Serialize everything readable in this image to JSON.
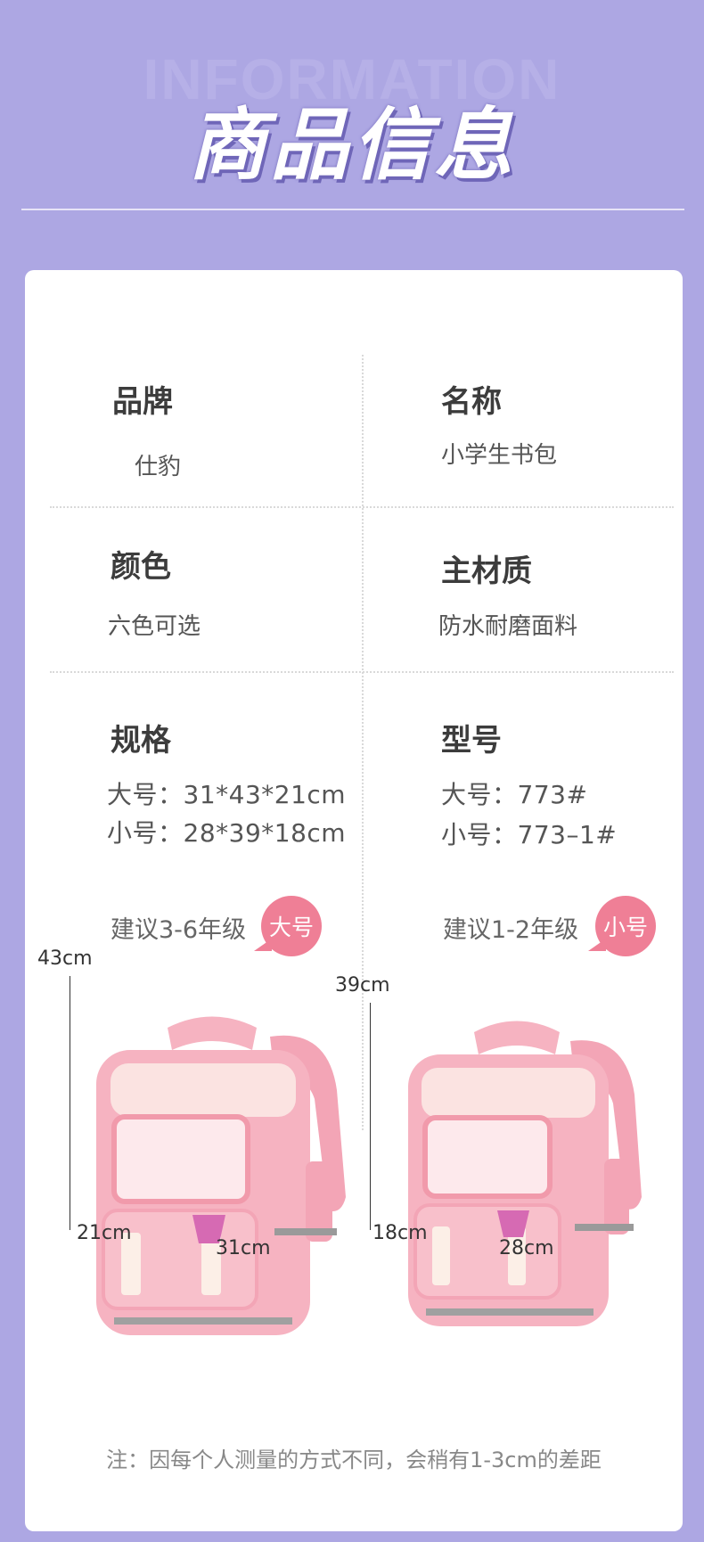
{
  "header": {
    "bg_word": "INFORMATION",
    "title": "商品信息"
  },
  "info": {
    "brand": {
      "label": "品牌",
      "value": "仕豹"
    },
    "name": {
      "label": "名称",
      "value": "小学生书包"
    },
    "color": {
      "label": "颜色",
      "value": "六色可选"
    },
    "material": {
      "label": "主材质",
      "value": "防水耐磨面料"
    },
    "spec": {
      "label": "规格",
      "large": "大号：31*43*21cm",
      "small": "小号：28*39*18cm"
    },
    "model": {
      "label": "型号",
      "large": "大号：773#",
      "small": "小号：773–1#"
    }
  },
  "sizes": [
    {
      "tip": "建议3-6年级",
      "badge": "大号",
      "height": "43cm",
      "depth": "21cm",
      "width": "31cm"
    },
    {
      "tip": "建议1-2年级",
      "badge": "小号",
      "height": "39cm",
      "depth": "18cm",
      "width": "28cm"
    }
  ],
  "note": "注：因每个人测量的方式不同，会稍有1-3cm的差距",
  "colors": {
    "background": "#ada7e3",
    "badge": "#ef7f96",
    "bag_pink": "#f6b3c1"
  },
  "icons": [
    "pink-backpack-icon"
  ]
}
